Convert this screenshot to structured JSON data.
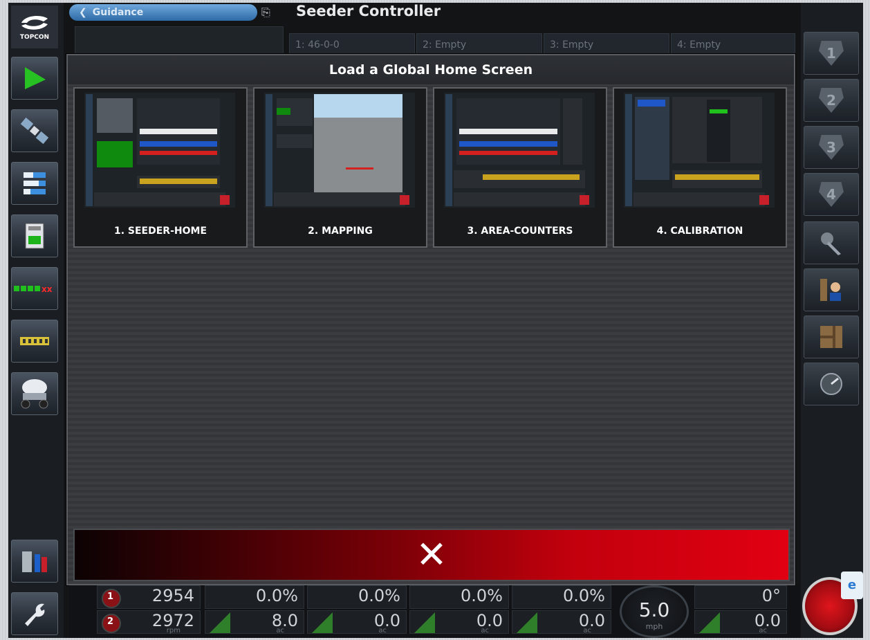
{
  "header": {
    "guidance_label": "Guidance",
    "app_title": "Seeder Controller",
    "bins": [
      "1: 46-0-0",
      "2: Empty",
      "3: Empty",
      "4: Empty"
    ]
  },
  "logo_text": "TOPCON",
  "modal": {
    "title": "Load a Global Home Screen",
    "screens": [
      {
        "label": "1. SEEDER-HOME"
      },
      {
        "label": "2. MAPPING"
      },
      {
        "label": "3. AREA-COUNTERS"
      },
      {
        "label": "4. CALIBRATION"
      }
    ],
    "close_symbol": "✕"
  },
  "right_toolbar": {
    "screen_buttons": [
      "1",
      "2",
      "3",
      "4"
    ]
  },
  "status": {
    "rpm": [
      {
        "id": "1",
        "value": "2954",
        "unit": "rpm"
      },
      {
        "id": "2",
        "value": "2972",
        "unit": "rpm"
      }
    ],
    "rates": [
      {
        "id": "1",
        "percent": "0.0%",
        "area": "8.0",
        "unit": "ac"
      },
      {
        "id": "2",
        "percent": "0.0%",
        "area": "0.0",
        "unit": "ac"
      },
      {
        "id": "3",
        "percent": "0.0%",
        "area": "0.0",
        "unit": "ac"
      },
      {
        "id": "4",
        "percent": "0.0%",
        "area": "0.0",
        "unit": "ac"
      }
    ],
    "speed": {
      "value": "5.0",
      "unit": "mph"
    },
    "heading": "0°",
    "total_area": {
      "value": "0.0",
      "unit": "ac"
    }
  }
}
